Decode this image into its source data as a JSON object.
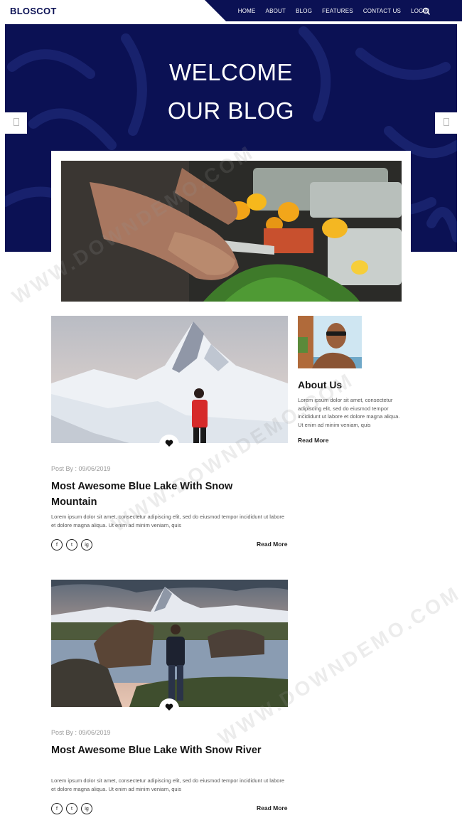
{
  "brand": {
    "name": "BLOSCOT"
  },
  "nav": {
    "items": [
      {
        "label": "HOME"
      },
      {
        "label": "ABOUT"
      },
      {
        "label": "BLOG"
      },
      {
        "label": "FEATURES"
      },
      {
        "label": "CONTACT US"
      },
      {
        "label": "LOGIN"
      }
    ],
    "search_icon": "search-icon"
  },
  "hero": {
    "line1": "WELCOME",
    "line2": "OUR BLOG",
    "prev_icon": "arrow-left-icon",
    "next_icon": "arrow-right-icon"
  },
  "posts": [
    {
      "meta": "Post By : 09/06/2019",
      "title": "Most Awesome Blue Lake With Snow Mountain",
      "excerpt": "Lorem ipsum dolor sit amet, consectetur adipiscing elit, sed do eiusmod tempor incididunt ut labore et dolore magna aliqua. Ut enim ad minim veniam, quis",
      "read_more": "Read More",
      "social": [
        "f",
        "t",
        "ig"
      ]
    },
    {
      "meta": "Post By : 09/06/2019",
      "title": "Most Awesome Blue Lake With Snow River",
      "excerpt": "Lorem ipsum dolor sit amet, consectetur adipiscing elit, sed do eiusmod tempor incididunt ut labore et dolore magna aliqua. Ut enim ad minim veniam, quis",
      "read_more": "Read More",
      "social": [
        "f",
        "t",
        "ig"
      ]
    }
  ],
  "sidebar": {
    "about_title": "About Us",
    "about_text": "Lorem ipsum dolor sit amet, consectetur adipiscing elit, sed do eiusmod tempor incididunt ut labore et dolore magna aliqua. Ut enim ad minim veniam, quis",
    "read_more": "Read More"
  },
  "watermark": "WWW.DOWNDEMO.COM",
  "colors": {
    "navy": "#0b1154",
    "white": "#ffffff",
    "text": "#151515"
  }
}
